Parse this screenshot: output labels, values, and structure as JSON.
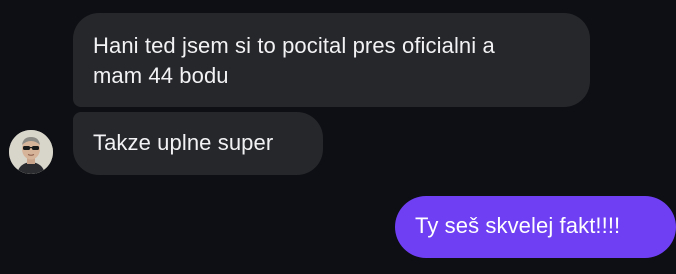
{
  "conversation": {
    "messages": [
      {
        "direction": "incoming",
        "lines": [
          "Hani ted jsem si to pocital pres oficialni a",
          "mam 44 bodu"
        ]
      },
      {
        "direction": "incoming",
        "text": "Takze uplne super"
      },
      {
        "direction": "outgoing",
        "text": "Ty seš skvelej fakt!!!!"
      }
    ],
    "sender_avatar": {
      "icon": "person-with-sunglasses-avatar"
    }
  },
  "colors": {
    "background": "#0d0f14",
    "incoming_bubble": "#26272b",
    "outgoing_bubble": "#6e3ff3",
    "text": "#f2f2f4"
  }
}
